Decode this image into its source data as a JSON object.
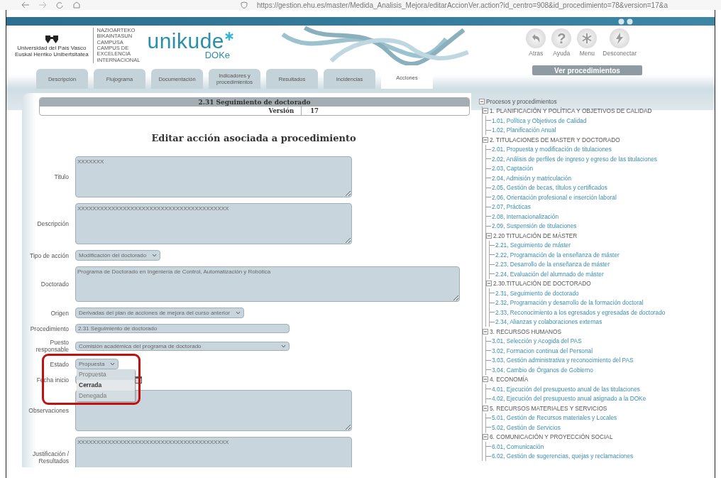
{
  "browser": {
    "url": "https://gestion.ehu.es/master/Medida_Analisis_Mejora/editarAccionVer.action?id_centro=908&id_procedimiento=78&version=17&a"
  },
  "header": {
    "university": "Universidad del País Vasco",
    "university_eu": "Euskal Herriko Unibertsitatea",
    "campus": [
      "NAZIOARTEKO",
      "BIKAINTASUN",
      "CAMPUSA",
      "CAMPUS DE",
      "EXCELENCIA",
      "INTERNACIONAL"
    ],
    "brand": "unikude",
    "brand_sub": "DOKe"
  },
  "nav_buttons": [
    {
      "kind": "back",
      "label": "Atras"
    },
    {
      "kind": "help",
      "glyph": "?",
      "label": "Ayuda"
    },
    {
      "kind": "menu",
      "label": "Menu"
    },
    {
      "kind": "disconnect",
      "label": "Desconectar"
    }
  ],
  "view_button": "Ver procedimientos",
  "tabs": [
    {
      "label": "Descripción",
      "selected": false
    },
    {
      "label": "Flujograma",
      "selected": false
    },
    {
      "label": "Documentación",
      "selected": false
    },
    {
      "label": "Indicadores y procedimientos",
      "selected": false
    },
    {
      "label": "Resultados",
      "selected": false
    },
    {
      "label": "Incidencias",
      "selected": false
    },
    {
      "label": "Acciones",
      "selected": true
    }
  ],
  "procedure": {
    "title": "2.31 Seguimiento de doctorado",
    "version_label": "Versión",
    "version": "17"
  },
  "form": {
    "heading": "Editar acción asociada a procedimiento",
    "fields": [
      {
        "kind": "textarea",
        "label": "Titulo",
        "value": "XXXXXXX"
      },
      {
        "kind": "textarea",
        "label": "Descripción",
        "value": "XXXXXXXXXXXXXXXXXXXXXXXXXXXXXXXXXXXXXXXX"
      },
      {
        "kind": "select",
        "label": "Tipo de acción",
        "value": "Modificación del doctorado"
      },
      {
        "kind": "longtext",
        "label": "Doctorado",
        "value": "Programa de Doctorado en Ingeniería de Control, Automatización y Robótica"
      },
      {
        "kind": "select",
        "label": "Origen",
        "value": "Derivadas del plan de acciones de mejora del curso anterior"
      },
      {
        "kind": "text",
        "label": "Procedimiento",
        "value": "2.31 Seguimiento de doctorado"
      },
      {
        "kind": "widelist",
        "label": "Puesto responsable",
        "value": "Comisión académica del programa de doctorado"
      },
      {
        "kind": "dropdown",
        "label": "Estado",
        "value": "Propuesta",
        "options": [
          {
            "label": "Propuesta",
            "highlighted": false
          },
          {
            "label": "Cerrada",
            "highlighted": true
          },
          {
            "label": "Denegada",
            "highlighted": false
          }
        ]
      },
      {
        "kind": "date",
        "label": "Fecha inicio"
      },
      {
        "kind": "textarea",
        "label": "Observaciones"
      },
      {
        "kind": "textarea",
        "label": "Justificación / Resultados",
        "value": "XXXXXXXXXXXXXXXXXXXXXXXXXXXXXXXXXXXXXXXX"
      }
    ]
  },
  "tree": {
    "label": "Procesos y procedimientos",
    "expanded": true,
    "children": [
      {
        "label": "1. PLANIFICACIÓN Y POLÍTICA Y OBJETIVOS DE CALIDAD",
        "expanded": true,
        "children": [
          {
            "label": "1.01, Política y Objetivos de Calidad"
          },
          {
            "label": "1.02, Planificación Anual"
          }
        ]
      },
      {
        "label": "2. TITULACIONES DE MASTER Y DOCTORADO",
        "expanded": true,
        "children": [
          {
            "label": "2.01, Propuesta y modificación de titulaciones"
          },
          {
            "label": "2.02, Análisis de perfiles de ingreso y egreso de las titulaciones"
          },
          {
            "label": "2.03, Captación"
          },
          {
            "label": "2.04, Admisión y matriculación"
          },
          {
            "label": "2.05, Gestión de becas, títulos y certificados"
          },
          {
            "label": "2.06, Orientación profesional e inserción laboral"
          },
          {
            "label": "2.07, Prácticas"
          },
          {
            "label": "2.08, Internacionalización"
          },
          {
            "label": "2.09, Suspensión de titulaciones"
          },
          {
            "label": "2.20 TITULACIÓN DE MÁSTER",
            "expanded": true,
            "children": [
              {
                "label": "2.21, Seguimiento de máster"
              },
              {
                "label": "2.22, Programación de la enseñanza de máster"
              },
              {
                "label": "2.23, Desarrollo de la enseñanza de máster"
              },
              {
                "label": "2.24, Evaluación del alumnado de máster"
              }
            ]
          },
          {
            "label": "2.30.TITULACIÓN DE DOCTORADO",
            "expanded": true,
            "children": [
              {
                "label": "2.31, Seguimiento de doctorado"
              },
              {
                "label": "2.32, Programación y desarrollo de la formación doctoral"
              },
              {
                "label": "2.33, Reconocimiento a los egresados y egresadas de doctorado"
              },
              {
                "label": "2.34, Alianzas y colaboraciones externas"
              }
            ]
          }
        ]
      },
      {
        "label": "3. RECURSOS HUMANOS",
        "expanded": true,
        "children": [
          {
            "label": "3.01, Selección y Acogida del PAS"
          },
          {
            "label": "3.02, Formacion continua del Personal"
          },
          {
            "label": "3.03, Gestión administrativa y reconocimiento del PAS"
          },
          {
            "label": "3.04, Cambio de Órganos de Gobierno"
          }
        ]
      },
      {
        "label": "4. ECONOMÍA",
        "expanded": true,
        "children": [
          {
            "label": "4.01, Ejecución del presupuesto anual de las titulaciones"
          },
          {
            "label": "4.02, Ejecución del presupuesto anual asignado a la DOKe"
          }
        ]
      },
      {
        "label": "5. RECURSOS MATERIALES Y SERVICIOS",
        "expanded": true,
        "children": [
          {
            "label": "5.01, Gestión de Recursos materiales y Locales"
          },
          {
            "label": "5.02, Gestión de Servicios"
          }
        ]
      },
      {
        "label": "6. COMUNICACIÓN Y PROYECCIÓN SOCIAL",
        "expanded": true,
        "children": [
          {
            "label": "6.01, Comunicación"
          },
          {
            "label": "6.02, Gestión de sugerencias, quejas y reclamaciones"
          }
        ]
      }
    ]
  }
}
